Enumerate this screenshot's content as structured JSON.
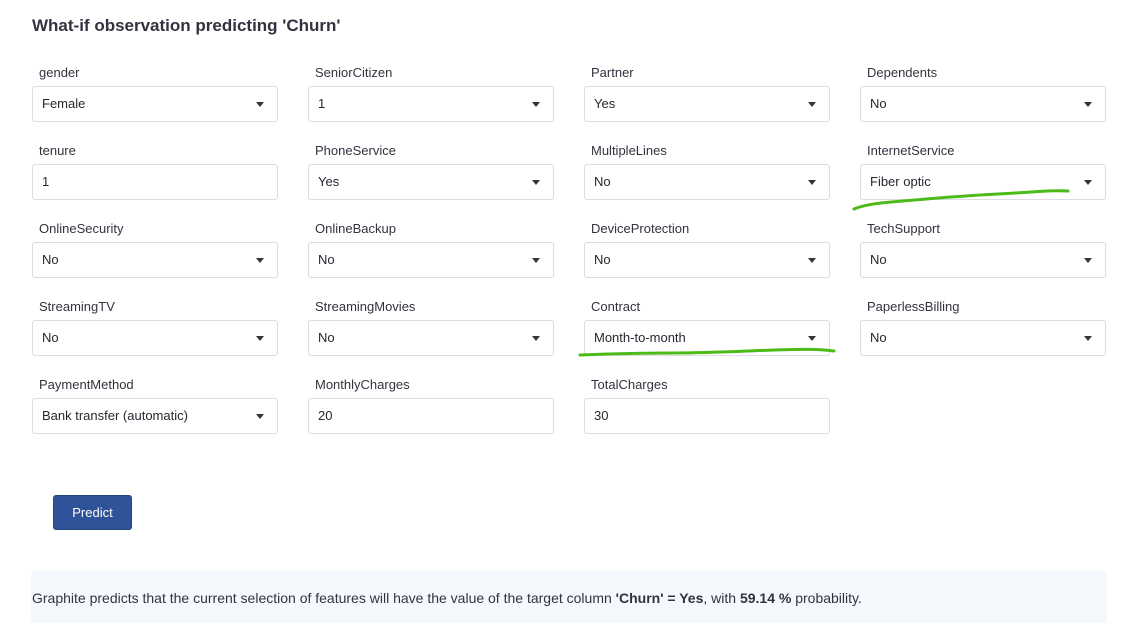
{
  "title": "What-if observation predicting 'Churn'",
  "fields": [
    {
      "label": "gender",
      "value": "Female",
      "type": "select"
    },
    {
      "label": "SeniorCitizen",
      "value": "1",
      "type": "select"
    },
    {
      "label": "Partner",
      "value": "Yes",
      "type": "select"
    },
    {
      "label": "Dependents",
      "value": "No",
      "type": "select"
    },
    {
      "label": "tenure",
      "value": "1",
      "type": "input"
    },
    {
      "label": "PhoneService",
      "value": "Yes",
      "type": "select"
    },
    {
      "label": "MultipleLines",
      "value": "No",
      "type": "select"
    },
    {
      "label": "InternetService",
      "value": "Fiber optic",
      "type": "select"
    },
    {
      "label": "OnlineSecurity",
      "value": "No",
      "type": "select"
    },
    {
      "label": "OnlineBackup",
      "value": "No",
      "type": "select"
    },
    {
      "label": "DeviceProtection",
      "value": "No",
      "type": "select"
    },
    {
      "label": "TechSupport",
      "value": "No",
      "type": "select"
    },
    {
      "label": "StreamingTV",
      "value": "No",
      "type": "select"
    },
    {
      "label": "StreamingMovies",
      "value": "No",
      "type": "select"
    },
    {
      "label": "Contract",
      "value": "Month-to-month",
      "type": "select"
    },
    {
      "label": "PaperlessBilling",
      "value": "No",
      "type": "select"
    },
    {
      "label": "PaymentMethod",
      "value": "Bank transfer (automatic)",
      "type": "select"
    },
    {
      "label": "MonthlyCharges",
      "value": "20",
      "type": "input"
    },
    {
      "label": "TotalCharges",
      "value": "30",
      "type": "input"
    }
  ],
  "predict_label": "Predict",
  "result": {
    "prefix": "Graphite predicts that the current selection of features will have the value of the target column ",
    "target": "'Churn' = Yes",
    "middle": ", with ",
    "probability": "59.14 %",
    "suffix": " probability."
  },
  "colors": {
    "button": "#2f5398",
    "annotation": "#4cbb17"
  }
}
